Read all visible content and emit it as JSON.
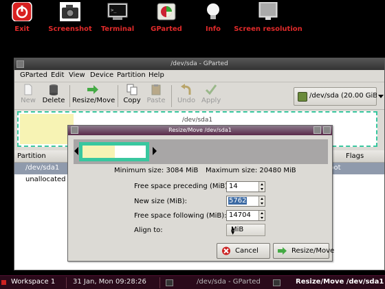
{
  "launchers": [
    {
      "label": "Exit",
      "icon": "power-icon"
    },
    {
      "label": "Screenshot",
      "icon": "camera-icon"
    },
    {
      "label": "Terminal",
      "icon": "terminal-icon"
    },
    {
      "label": "GParted",
      "icon": "gparted-icon"
    },
    {
      "label": "Info",
      "icon": "lightbulb-icon"
    },
    {
      "label": "Screen resolution",
      "icon": "monitor-icon"
    }
  ],
  "window": {
    "title": "/dev/sda - GParted",
    "menu": [
      "GParted",
      "Edit",
      "View",
      "Device",
      "Partition",
      "Help"
    ],
    "toolbar": {
      "new": "New",
      "delete": "Delete",
      "resize_move": "Resize/Move",
      "copy": "Copy",
      "paste": "Paste",
      "undo": "Undo",
      "apply": "Apply"
    },
    "device_selector": "/dev/sda  (20.00 GiB)",
    "disk_label": "/dev/sda1",
    "columns": {
      "partition": "Partition",
      "flags": "Flags"
    },
    "rows": [
      {
        "partition": "/dev/sda1",
        "flags": "boot"
      },
      {
        "partition": "unallocated",
        "flags": ""
      }
    ]
  },
  "dialog": {
    "title": "Resize/Move /dev/sda1",
    "min_size": "Minimum size: 3084 MiB",
    "max_size": "Maximum size: 20480 MiB",
    "fields": {
      "preceding_label": "Free space preceding (MiB):",
      "preceding_value": "14",
      "new_size_label": "New size (MiB):",
      "new_size_value": "5762",
      "following_label": "Free space following (MiB):",
      "following_value": "14704",
      "align_label": "Align to:",
      "align_value": "MiB"
    },
    "cancel": "Cancel",
    "resize_move": "Resize/Move"
  },
  "taskbar": {
    "workspace": "Workspace 1",
    "clock": "31 Jan, Mon 09:28:26",
    "task1": "/dev/sda - GParted",
    "task2": "Resize/Move /dev/sda1"
  },
  "colors": {
    "launcher_label": "#e02a2a",
    "partition_border": "#38c79f",
    "used_space": "#f7f3b4",
    "dialog_title": "#5a2a4a",
    "taskbar": "#2a0a1a"
  }
}
